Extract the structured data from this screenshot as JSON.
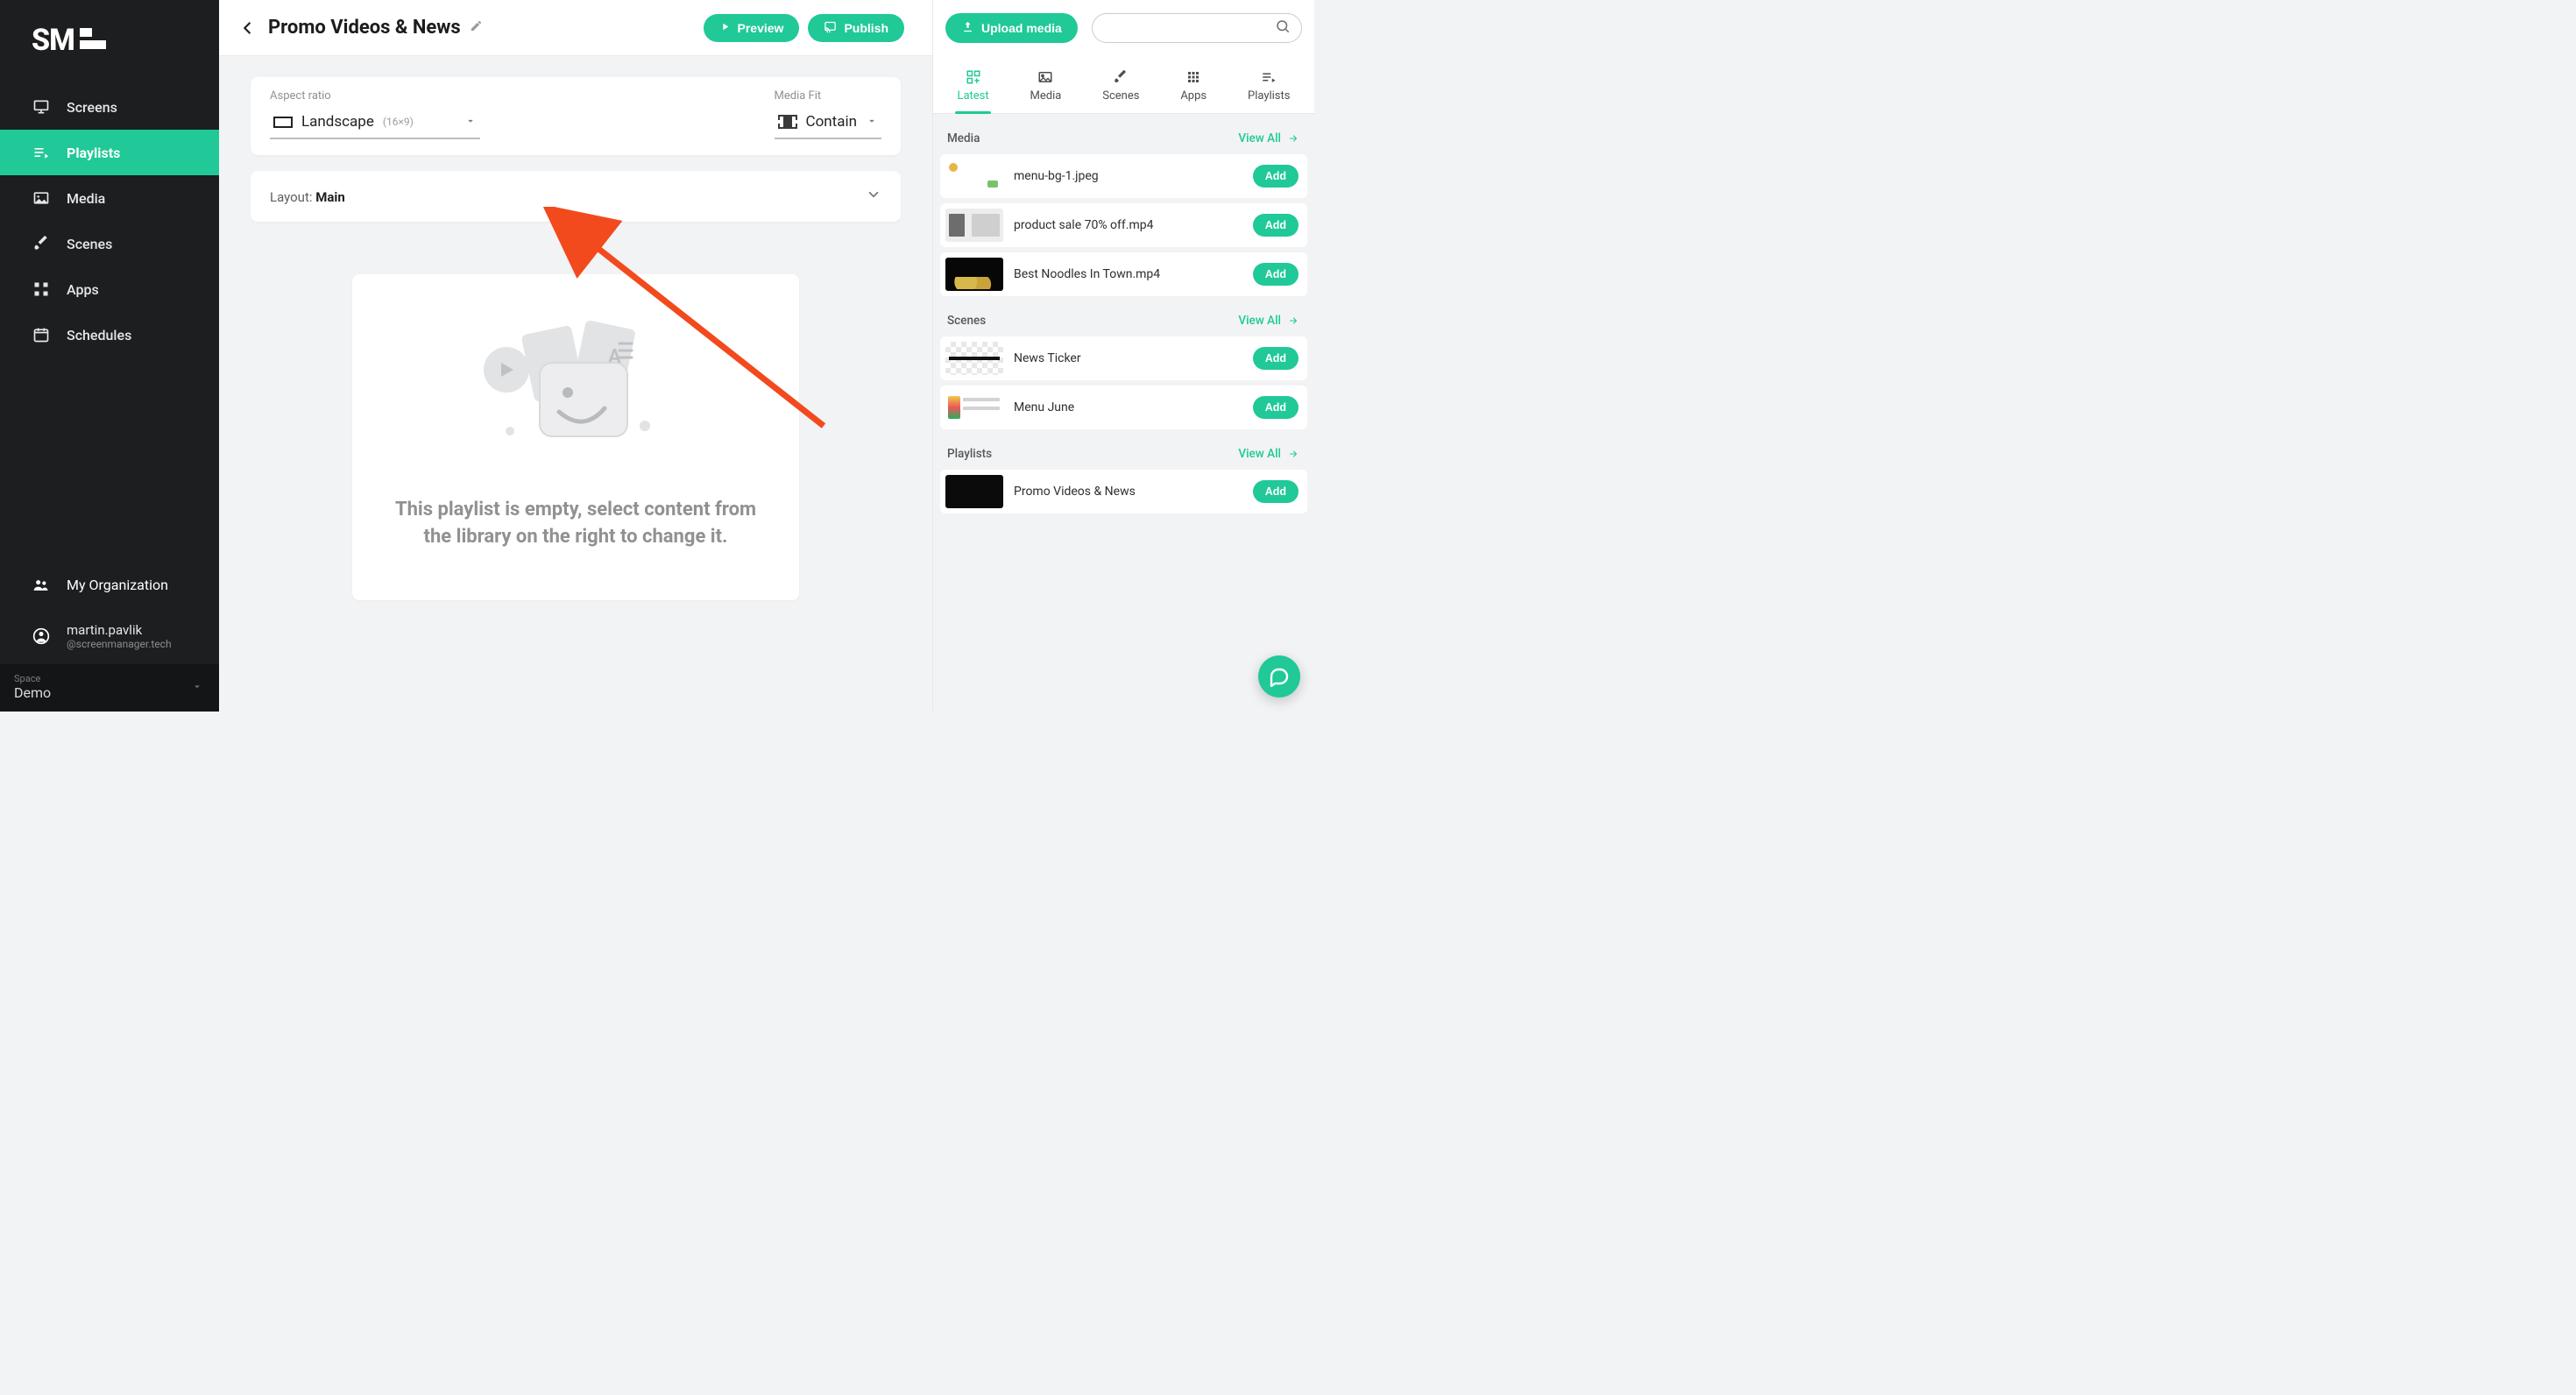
{
  "brand": {
    "name": "SM"
  },
  "sidebar": {
    "items": [
      {
        "label": "Screens"
      },
      {
        "label": "Playlists"
      },
      {
        "label": "Media"
      },
      {
        "label": "Scenes"
      },
      {
        "label": "Apps"
      },
      {
        "label": "Schedules"
      }
    ],
    "org_label": "My Organization",
    "user": {
      "name": "martin.pavlik",
      "email": "@screenmanager.tech"
    },
    "space_label": "Space",
    "space_value": "Demo"
  },
  "header": {
    "title": "Promo Videos & News",
    "preview_label": "Preview",
    "publish_label": "Publish"
  },
  "settings": {
    "aspect_label": "Aspect ratio",
    "aspect_value": "Landscape",
    "aspect_meta": "(16×9)",
    "fit_label": "Media Fit",
    "fit_value": "Contain"
  },
  "layout": {
    "prefix": "Layout: ",
    "name": "Main"
  },
  "empty": {
    "text": "This playlist is empty, select content from the library on the right to change it."
  },
  "right": {
    "upload_label": "Upload media",
    "search_placeholder": "",
    "tabs": [
      {
        "label": "Latest"
      },
      {
        "label": "Media"
      },
      {
        "label": "Scenes"
      },
      {
        "label": "Apps"
      },
      {
        "label": "Playlists"
      }
    ],
    "view_all_label": "View All",
    "add_label": "Add",
    "sections": {
      "media": {
        "title": "Media",
        "items": [
          {
            "name": "menu-bg-1.jpeg"
          },
          {
            "name": "product sale 70% off.mp4"
          },
          {
            "name": "Best Noodles In Town.mp4"
          }
        ]
      },
      "scenes": {
        "title": "Scenes",
        "items": [
          {
            "name": "News Ticker"
          },
          {
            "name": "Menu June"
          }
        ]
      },
      "playlists": {
        "title": "Playlists",
        "items": [
          {
            "name": "Promo Videos & News"
          }
        ]
      }
    }
  }
}
